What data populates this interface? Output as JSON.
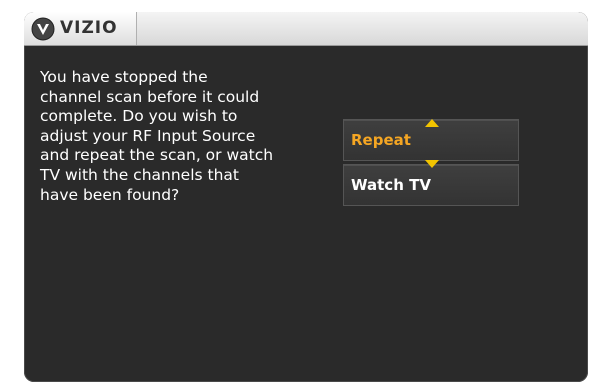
{
  "header": {
    "logo_text": "VIZIO",
    "logo_icon": "vizio-v-badge-icon"
  },
  "dialog": {
    "message": "You have stopped the\nchannel scan before it could\ncomplete. Do you wish to\nadjust your RF Input Source\nand repeat the scan, or watch\nTV with the channels that\nhave been found?",
    "options": [
      {
        "label": "Repeat",
        "selected": true
      },
      {
        "label": "Watch TV",
        "selected": false
      }
    ]
  },
  "colors": {
    "background": "#2a2a2a",
    "selected_text": "#f5a623",
    "arrow": "#f2c400",
    "text": "#ffffff"
  },
  "icons": {
    "up": "arrow-up-icon",
    "down": "arrow-down-icon"
  }
}
